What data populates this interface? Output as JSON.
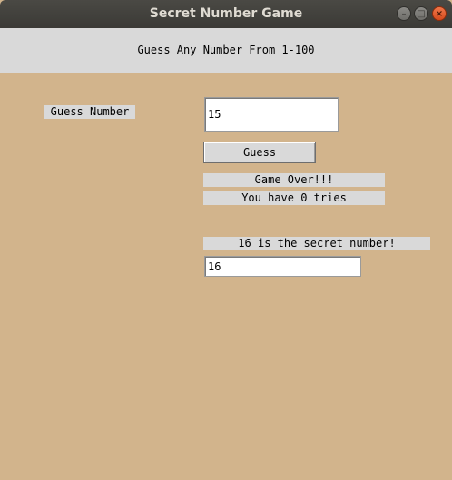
{
  "window": {
    "title": "Secret Number Game",
    "controls": {
      "minimize_icon": "minimize-icon",
      "maximize_icon": "maximize-icon",
      "close_icon": "close-icon"
    }
  },
  "header": {
    "instruction": "Guess Any Number From 1-100"
  },
  "form": {
    "guess_label": "Guess Number",
    "guess_value": "15",
    "guess_button_label": "Guess"
  },
  "status": {
    "game_over": "Game Over!!!",
    "tries": "You have 0 tries"
  },
  "reveal": {
    "secret_text": "16 is the secret number!",
    "secret_value": "16"
  },
  "colors": {
    "background": "#d2b48c",
    "label_background": "#d9d9d9",
    "titlebar": "#3b3a36",
    "close_button": "#e05a2b"
  }
}
